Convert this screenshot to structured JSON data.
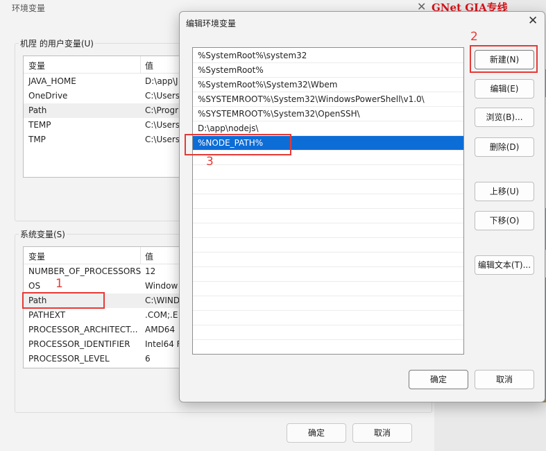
{
  "background_window": {
    "title": "环境变量",
    "user_group": {
      "label": "机陧 的用户变量(U)"
    },
    "user_vars": {
      "col_var": "变量",
      "col_val": "值",
      "rows": [
        {
          "name": "JAVA_HOME",
          "value": "D:\\app\\J"
        },
        {
          "name": "OneDrive",
          "value": "C:\\Users"
        },
        {
          "name": "Path",
          "value": "C:\\Progr"
        },
        {
          "name": "TEMP",
          "value": "C:\\Users"
        },
        {
          "name": "TMP",
          "value": "C:\\Users"
        }
      ]
    },
    "system_group": {
      "label": "系统变量(S)"
    },
    "system_vars": {
      "col_var": "变量",
      "col_val": "值",
      "rows": [
        {
          "name": "NUMBER_OF_PROCESSORS",
          "value": "12"
        },
        {
          "name": "OS",
          "value": "Window"
        },
        {
          "name": "Path",
          "value": "C:\\WIND"
        },
        {
          "name": "PATHEXT",
          "value": ".COM;.E"
        },
        {
          "name": "PROCESSOR_ARCHITECT...",
          "value": "AMD64"
        },
        {
          "name": "PROCESSOR_IDENTIFIER",
          "value": "Intel64 F"
        },
        {
          "name": "PROCESSOR_LEVEL",
          "value": "6"
        }
      ]
    },
    "ok_label": "确定",
    "cancel_label": "取消"
  },
  "banner_text": "GNet GIA专线",
  "dialog": {
    "title": "编辑环境变量",
    "paths": [
      "%SystemRoot%\\system32",
      "%SystemRoot%",
      "%SystemRoot%\\System32\\Wbem",
      "%SYSTEMROOT%\\System32\\WindowsPowerShell\\v1.0\\",
      "%SYSTEMROOT%\\System32\\OpenSSH\\",
      "D:\\app\\nodejs\\",
      "%NODE_PATH%"
    ],
    "selected_index": 6,
    "buttons": {
      "new": "新建(N)",
      "edit": "编辑(E)",
      "browse": "浏览(B)...",
      "delete": "删除(D)",
      "move_up": "上移(U)",
      "move_down": "下移(O)",
      "edit_text": "编辑文本(T)...",
      "ok": "确定",
      "cancel": "取消"
    }
  },
  "annotations": {
    "step1": "1",
    "step2": "2",
    "step3": "3"
  },
  "colors": {
    "selection": "#0d6dd7",
    "annotation_red": "#e53935",
    "banner_red": "#d8131b"
  }
}
